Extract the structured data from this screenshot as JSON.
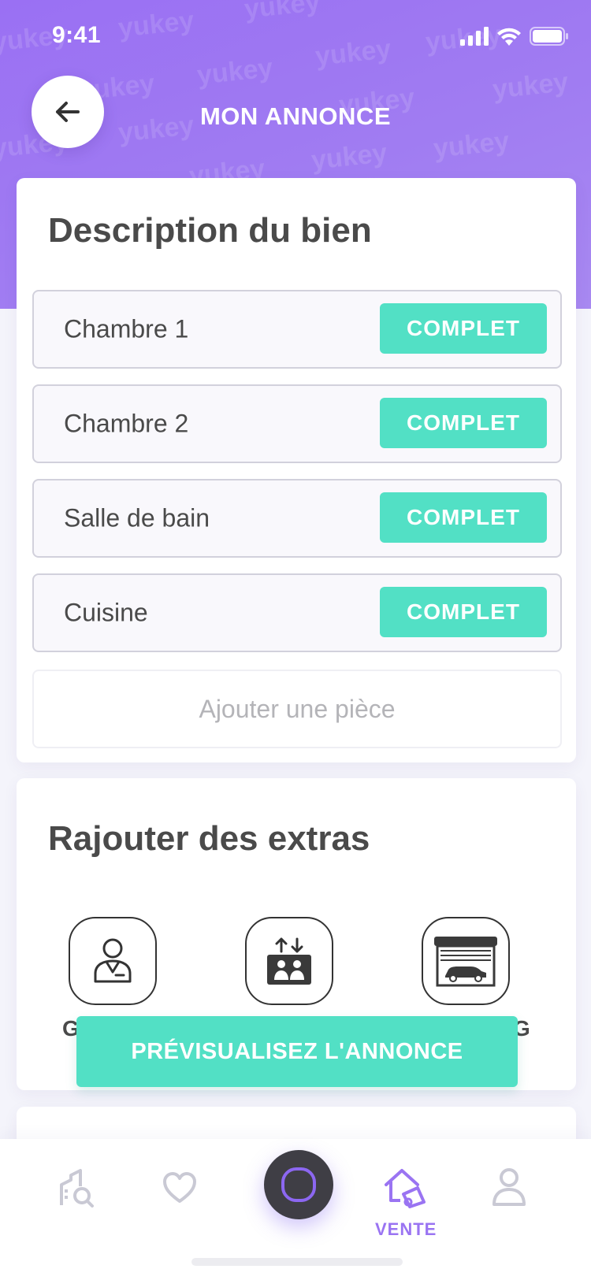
{
  "status_bar": {
    "time": "9:41"
  },
  "header": {
    "title": "MON ANNONCE",
    "watermark": "yukey",
    "gradient_color": "#9a70f3"
  },
  "description": {
    "title": "Description du bien",
    "rooms": [
      {
        "label": "Chambre 1",
        "status": "COMPLET"
      },
      {
        "label": "Chambre 2",
        "status": "COMPLET"
      },
      {
        "label": "Salle de bain",
        "status": "COMPLET"
      },
      {
        "label": "Cuisine",
        "status": "COMPLET"
      }
    ],
    "add_room_label": "Ajouter une pièce"
  },
  "extras": {
    "title": "Rajouter des extras",
    "items": [
      {
        "icon": "caretaker-icon",
        "label_visible": "G"
      },
      {
        "icon": "elevator-icon",
        "label_visible": ""
      },
      {
        "icon": "garage-icon",
        "label_visible": "G"
      }
    ]
  },
  "preview_button": {
    "label": "PRÉVISUALISEZ L'ANNONCE"
  },
  "tab_bar": {
    "items": [
      {
        "icon": "search-property-icon",
        "label": ""
      },
      {
        "icon": "heart-icon",
        "label": ""
      },
      {
        "icon": "assistant-icon",
        "label": ""
      },
      {
        "icon": "sell-house-icon",
        "label": "VENTE",
        "active": true
      },
      {
        "icon": "profile-icon",
        "label": ""
      }
    ]
  },
  "colors": {
    "accent": "#52e0c5",
    "brand": "#9a74f2",
    "text": "#4a4a4a"
  }
}
